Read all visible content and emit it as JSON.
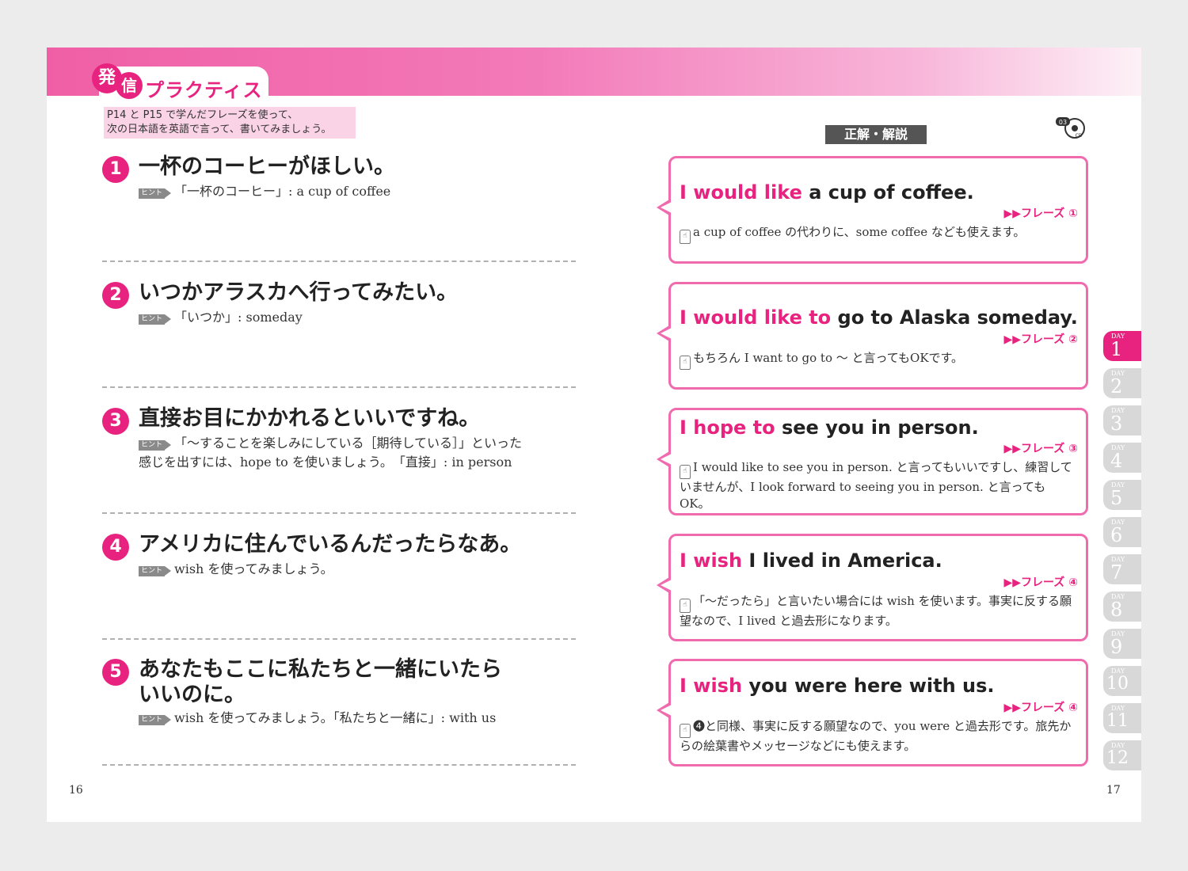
{
  "header": {
    "logo_char_1": "発",
    "logo_char_2": "信",
    "title": "プラクティス",
    "instruction_line1": "P14 と P15 で学んだフレーズを使って、",
    "instruction_line2": "次の日本語を英語で言って、書いてみましょう。"
  },
  "hint_label": "ヒント",
  "questions": [
    {
      "num": "1",
      "text": "一杯のコーヒーがほしい。",
      "hint": "「一杯のコーヒー」: a cup of coffee"
    },
    {
      "num": "2",
      "text": "いつかアラスカへ行ってみたい。",
      "hint": "「いつか」: someday"
    },
    {
      "num": "3",
      "text": "直接お目にかかれるといいですね。",
      "hint": "「～することを楽しみにしている［期待している］」といった感じを出すには、hope to を使いましょう。　「直接」: in person"
    },
    {
      "num": "4",
      "text": "アメリカに住んでいるんだったらなあ。",
      "hint": "wish を使ってみましょう。"
    },
    {
      "num": "5",
      "text": "あなたもここに私たちと一緒にいたらいいのに。",
      "hint": "wish を使ってみましょう。「私たちと一緒に」: with us"
    }
  ],
  "answers_label": "正解・解説",
  "cd": {
    "track": "03",
    "label": "CD"
  },
  "answers": [
    {
      "hl": "I would like",
      "rest": " a cup of coffee.",
      "phrase": "▶▶フレーズ ①",
      "note": "a cup of coffee の代わりに、some coffee なども使えます。"
    },
    {
      "hl": "I would like to",
      "rest": " go to Alaska someday.",
      "phrase": "▶▶フレーズ ②",
      "note": "もちろん I want to go to ～ と言ってもOKです。"
    },
    {
      "hl": "I hope to",
      "rest": " see you in person.",
      "phrase": "▶▶フレーズ ③",
      "note": "I would like to see you in person. と言ってもいいですし、練習していませんが、I look forward to seeing you in person. と言ってもOK。"
    },
    {
      "hl": "I wish",
      "rest": " I lived in America.",
      "phrase": "▶▶フレーズ ④",
      "note": "「～だったら」と言いたい場合には wish を使います。事実に反する願望なので、I lived と過去形になります。"
    },
    {
      "hl": "I wish",
      "rest": " you were here with us.",
      "phrase": "▶▶フレーズ ④",
      "note": "❹と同様、事実に反する願望なので、you were と過去形です。旅先からの絵葉書やメッセージなどにも使えます。"
    }
  ],
  "day_label": "DAY",
  "days": [
    "1",
    "2",
    "3",
    "4",
    "5",
    "6",
    "7",
    "8",
    "9",
    "10",
    "11",
    "12"
  ],
  "active_day": "1",
  "page_left": "16",
  "page_right": "17",
  "colors": {
    "accent": "#e8237f",
    "card_border": "#f06aae",
    "inactive_tab": "#d8d8d8"
  }
}
